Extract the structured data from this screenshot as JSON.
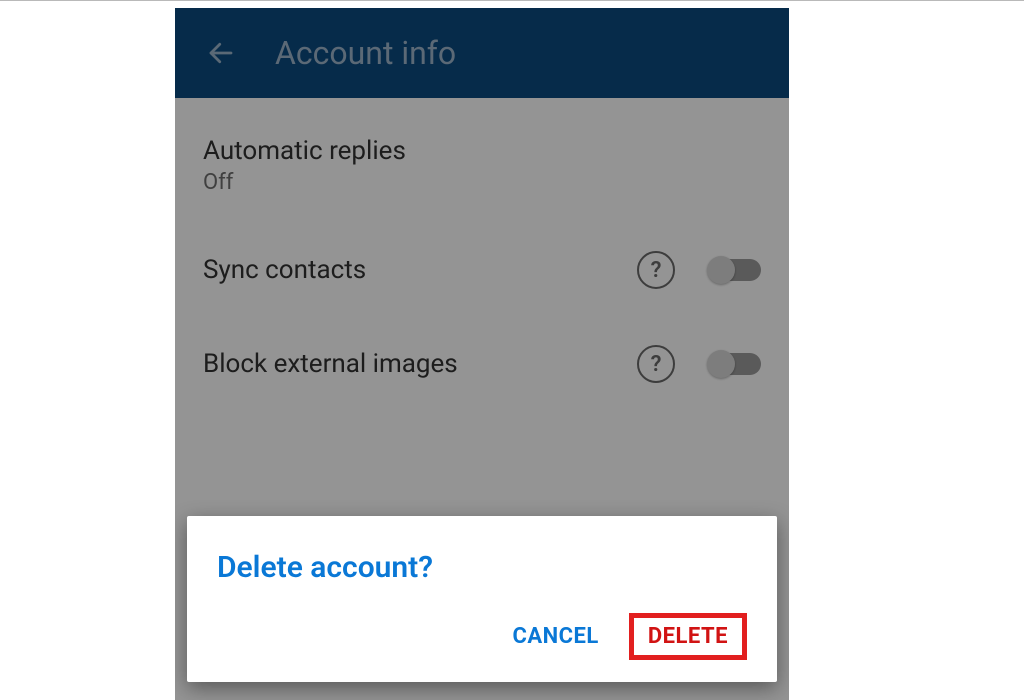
{
  "header": {
    "title": "Account info"
  },
  "settings": {
    "autoReplies": {
      "label": "Automatic replies",
      "status": "Off"
    },
    "syncContacts": {
      "label": "Sync contacts"
    },
    "blockImages": {
      "label": "Block external images"
    }
  },
  "dialog": {
    "title": "Delete account?",
    "cancel": "CANCEL",
    "delete": "DELETE"
  },
  "icons": {
    "help": "?"
  }
}
